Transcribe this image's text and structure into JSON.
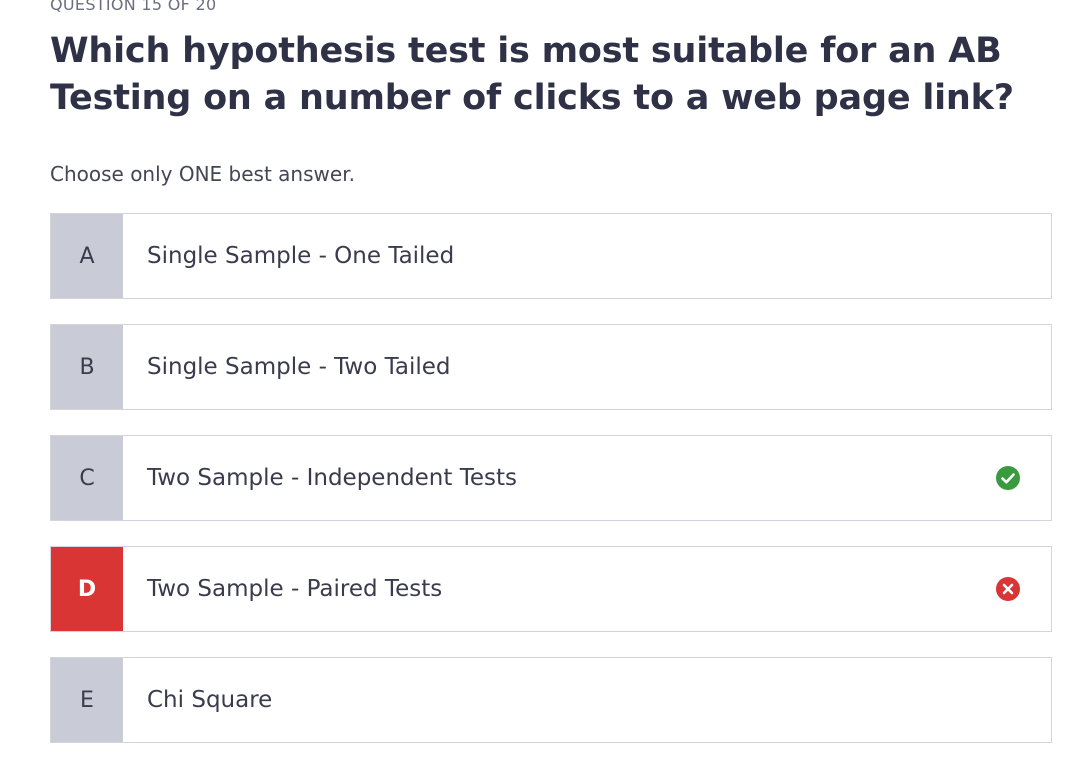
{
  "quiz": {
    "counter": "QUESTION 15 OF 20",
    "question": "Which hypothesis test is most suitable for an AB Testing on a number of clicks to a web page link?",
    "instruction": "Choose only ONE best answer."
  },
  "options": [
    {
      "letter": "A",
      "text": "Single Sample - One Tailed",
      "state": "default"
    },
    {
      "letter": "B",
      "text": "Single Sample - Two Tailed",
      "state": "default"
    },
    {
      "letter": "C",
      "text": "Two Sample - Independent Tests",
      "state": "correct",
      "icon": "check-circle-icon"
    },
    {
      "letter": "D",
      "text": "Two Sample - Paired Tests",
      "state": "selected-wrong",
      "icon": "x-circle-icon"
    },
    {
      "letter": "E",
      "text": "Chi Square",
      "state": "default"
    }
  ],
  "colors": {
    "correct": "#3a9a3f",
    "wrong": "#d93535",
    "letter_bg": "#c9ccd6"
  }
}
